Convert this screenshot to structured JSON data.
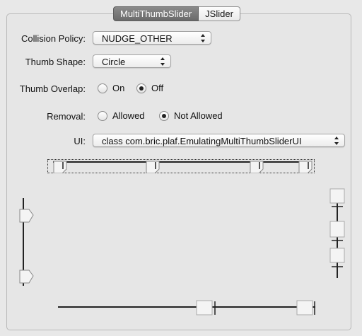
{
  "tabs": [
    "MultiThumbSlider",
    "JSlider"
  ],
  "form": {
    "collision_label": "Collision Policy:",
    "collision_value": "NUDGE_OTHER",
    "shape_label": "Thumb Shape:",
    "shape_value": "Circle",
    "overlap_label": "Thumb Overlap:",
    "overlap_on": "On",
    "overlap_off": "Off",
    "overlap_selected": "Off",
    "removal_label": "Removal:",
    "removal_allowed": "Allowed",
    "removal_not_allowed": "Not Allowed",
    "removal_selected": "Not Allowed",
    "ui_label": "UI:",
    "ui_value": "class com.bric.plaf.EmulatingMultiThumbSliderUI"
  },
  "sliders": {
    "top_thumbs": 4,
    "left_thumbs": 2,
    "right_thumbs": 3,
    "bottom_thumbs": 2
  }
}
